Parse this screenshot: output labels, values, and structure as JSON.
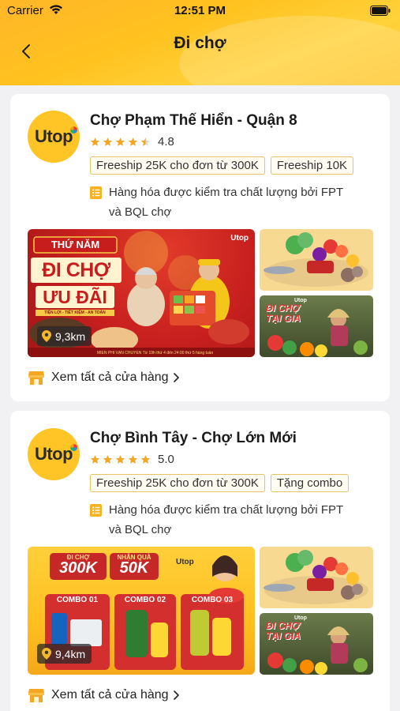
{
  "status_bar": {
    "carrier": "Carrier",
    "time": "12:51 PM"
  },
  "header": {
    "title": "Đi chợ"
  },
  "colors": {
    "brand_yellow": "#ffc425",
    "tag_border": "#e7c266",
    "star": "#f5a623"
  },
  "stores": [
    {
      "logo_text": "Utop",
      "name": "Chợ Phạm Thế Hiển - Quận 8",
      "rating": "4.8",
      "stars": 4.5,
      "promos": [
        "Freeship 25K cho đơn từ 300K",
        "Freeship 10K"
      ],
      "quality_line1": "Hàng hóa được kiểm tra chất lượng bởi FPT",
      "quality_line2": "và BQL chợ",
      "banner": {
        "line1": "THỨ NĂM",
        "line2": "ĐI CHỢ",
        "line3": "ƯU ĐÃI",
        "tagline": "TIỆN LỢI - TIẾT KIỆM - AN TOÀN",
        "brand": "Utop",
        "footer": "MIỄN PHÍ VẬN CHUYỂN  Từ 19h thứ 4 đến 24:00 thứ 5 hàng tuần"
      },
      "side_banner_text": "ĐI CHỢ TẠI GIA",
      "side_banner_brand": "Utop",
      "distance": "9,3km",
      "see_all": "Xem tất cả cửa hàng"
    },
    {
      "logo_text": "Utop",
      "name": "Chợ Bình Tây - Chợ Lớn Mới",
      "rating": "5.0",
      "stars": 5,
      "promos": [
        "Freeship 25K cho đơn từ 300K",
        "Tặng combo"
      ],
      "quality_line1": "Hàng hóa được kiểm tra chất lượng bởi FPT",
      "quality_line2": "và BQL chợ",
      "banner": {
        "pill1_top": "ĐI CHỢ",
        "pill1": "300K",
        "pill2_top": "NHẬN QUÀ",
        "pill2": "50K",
        "brand": "Utop",
        "combo1": "COMBO 01",
        "combo2": "COMBO 02",
        "combo3": "COMBO 03"
      },
      "side_banner_text": "ĐI CHỢ TẠI GIA",
      "side_banner_brand": "Utop",
      "distance": "9,4km",
      "see_all": "Xem tất cả cửa hàng"
    }
  ]
}
